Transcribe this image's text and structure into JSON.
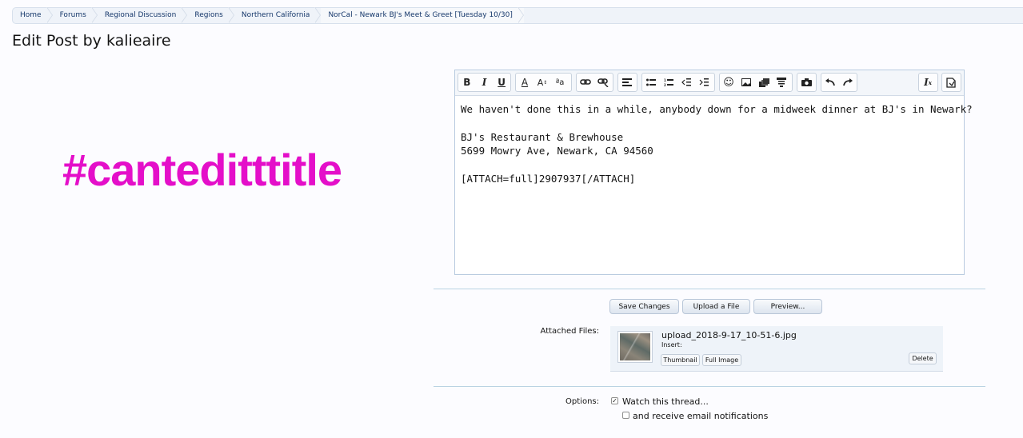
{
  "breadcrumb": [
    "Home",
    "Forums",
    "Regional Discussion",
    "Regions",
    "Northern California",
    "NorCal - Newark BJ's Meet & Greet [Tuesday 10/30]"
  ],
  "page_title": "Edit Post by kalieaire",
  "hashtag": "#canteditttitle",
  "editor": {
    "lines": [
      "We haven't done this in a while, anybody down for a midweek dinner at BJ's in Newark?",
      "",
      "BJ's Restaurant & Brewhouse",
      "5699 Mowry Ave, Newark, CA 94560",
      "",
      "[ATTACH=full]2907937[/ATTACH]"
    ]
  },
  "buttons": {
    "save": "Save Changes",
    "upload": "Upload a File",
    "preview": "Preview..."
  },
  "attached": {
    "label": "Attached Files:",
    "filename": "upload_2018-9-17_10-51-6.jpg",
    "insert_label": "Insert:",
    "thumbnail": "Thumbnail",
    "full_image": "Full Image",
    "delete": "Delete"
  },
  "options": {
    "label": "Options:",
    "watch": "Watch this thread...",
    "email": "and receive email notifications",
    "watch_checked": true,
    "email_checked": false
  },
  "colors": {
    "hashtag": "#e40fc9",
    "breadcrumb_text": "#16386b"
  }
}
